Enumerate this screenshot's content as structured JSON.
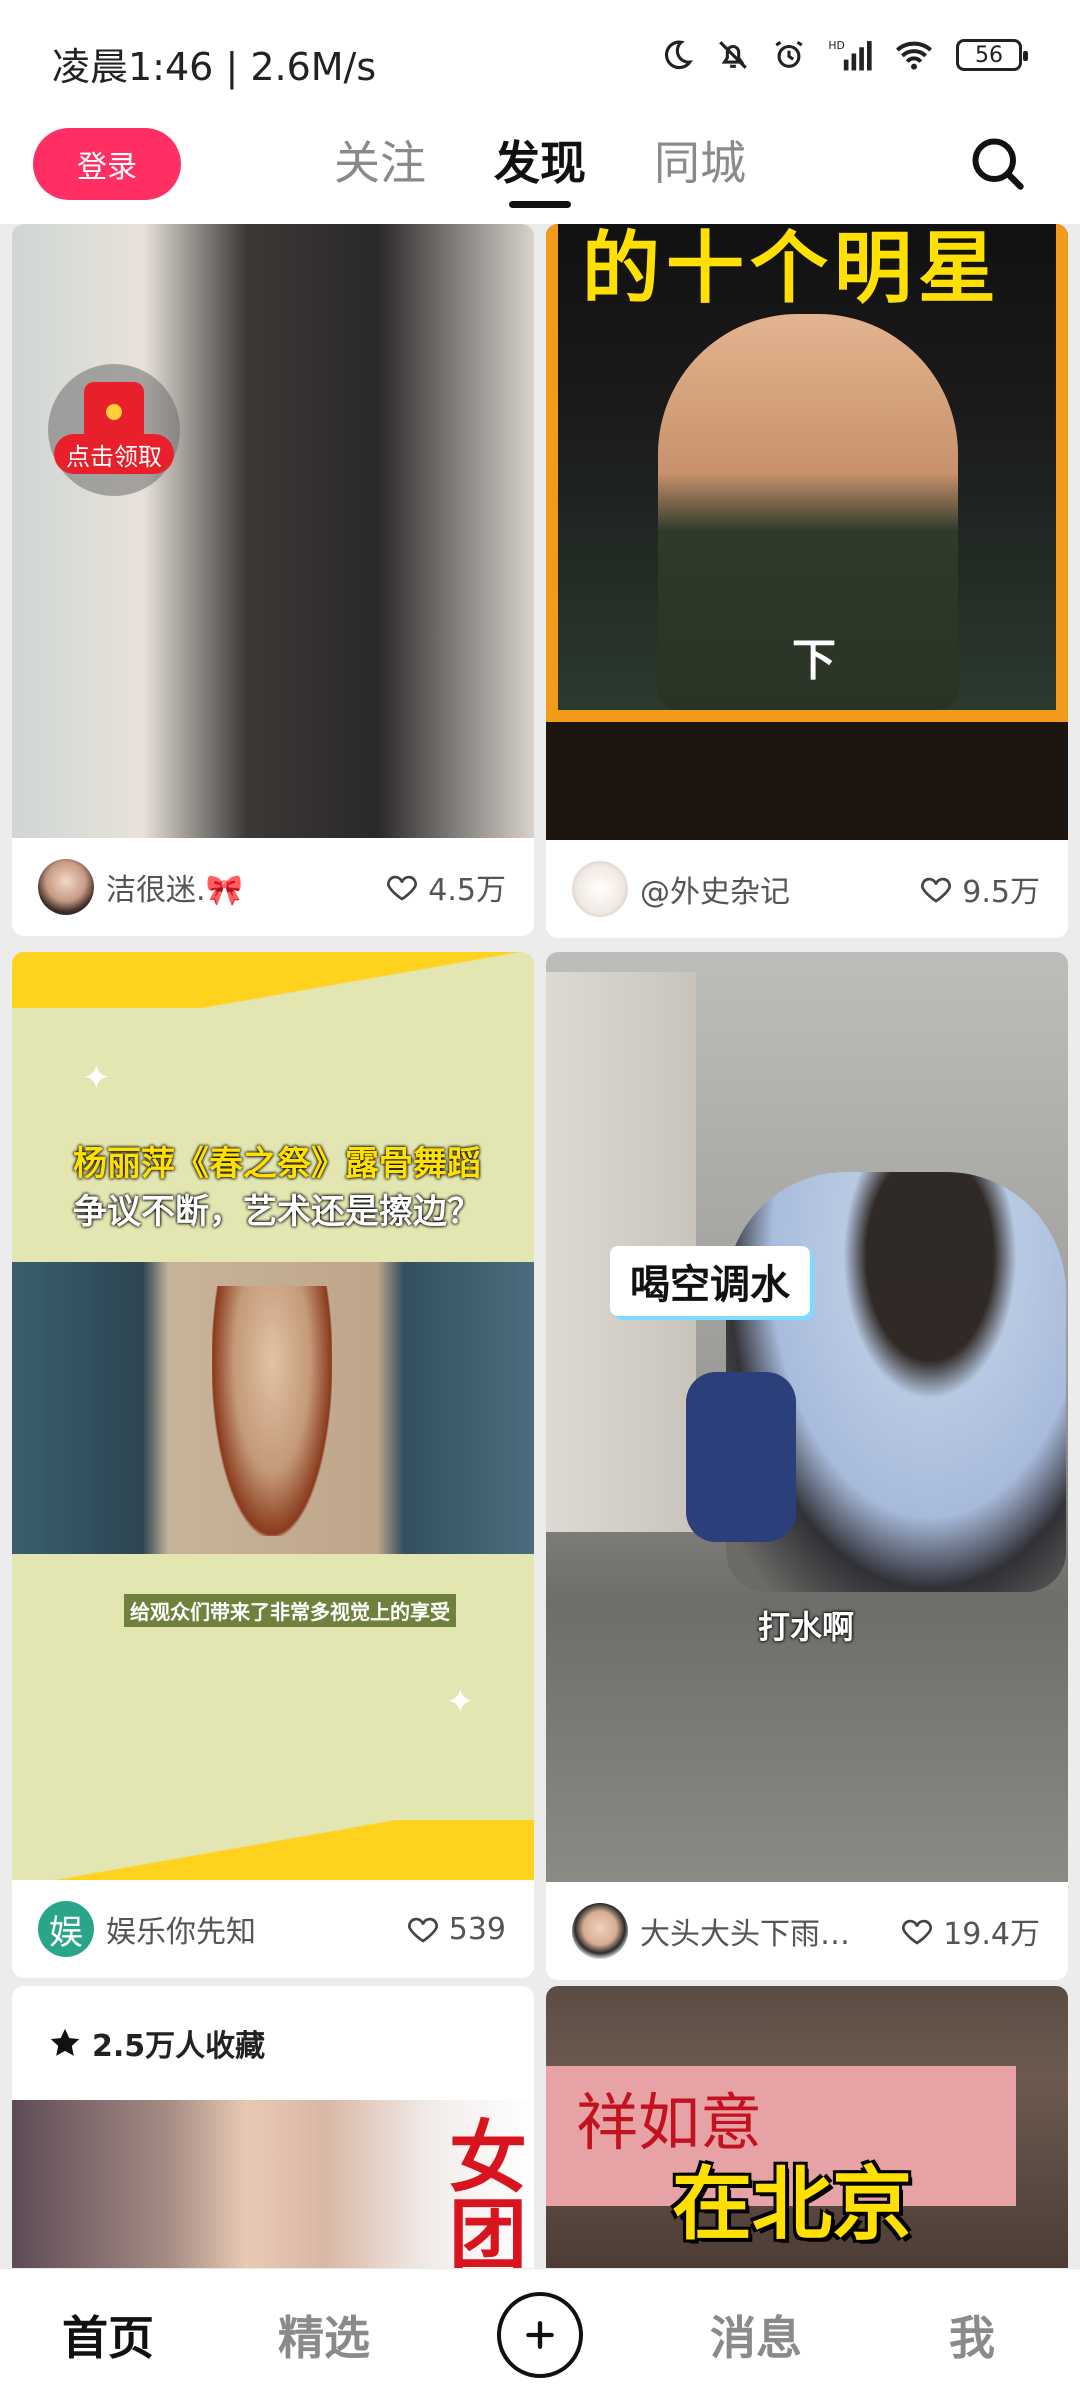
{
  "status_bar": {
    "time": "凌晨1:46",
    "speed": "| 2.6M/s",
    "battery": "56"
  },
  "header": {
    "login_label": "登录",
    "tabs": [
      {
        "label": "关注",
        "active": false
      },
      {
        "label": "发现",
        "active": true
      },
      {
        "label": "同城",
        "active": false
      }
    ]
  },
  "feed": {
    "cards": [
      {
        "author": "洁很迷.🎀",
        "likes": "4.5万",
        "badge": "点击领取"
      },
      {
        "author": "@外史杂记",
        "likes": "9.5万",
        "overlay_title": "的十个明星",
        "overlay_tag": "下"
      },
      {
        "author": "娱乐你先知",
        "likes": "539",
        "overlay_title_line1": "杨丽萍《春之祭》露骨舞蹈",
        "overlay_title_line2": "争议不断，艺术还是擦边？",
        "overlay_sub": "给观众们带来了非常多视觉上的享受"
      },
      {
        "author": "大头大头下雨…",
        "likes": "19.4万",
        "overlay_caption": "喝空调水",
        "overlay_sub": "打水啊"
      },
      {
        "collect_label": "2.5万人收藏",
        "overlay_title": "女团"
      },
      {
        "overlay_title": "在北京",
        "overlay_banner": "祥如意"
      }
    ]
  },
  "bottom_nav": {
    "items": [
      {
        "label": "首页",
        "active": true
      },
      {
        "label": "精选",
        "active": false
      },
      {
        "label": "消息",
        "active": false
      },
      {
        "label": "我",
        "active": false
      }
    ]
  },
  "colors": {
    "accent": "#ff2e63",
    "highlight_yellow": "#ffe000"
  }
}
